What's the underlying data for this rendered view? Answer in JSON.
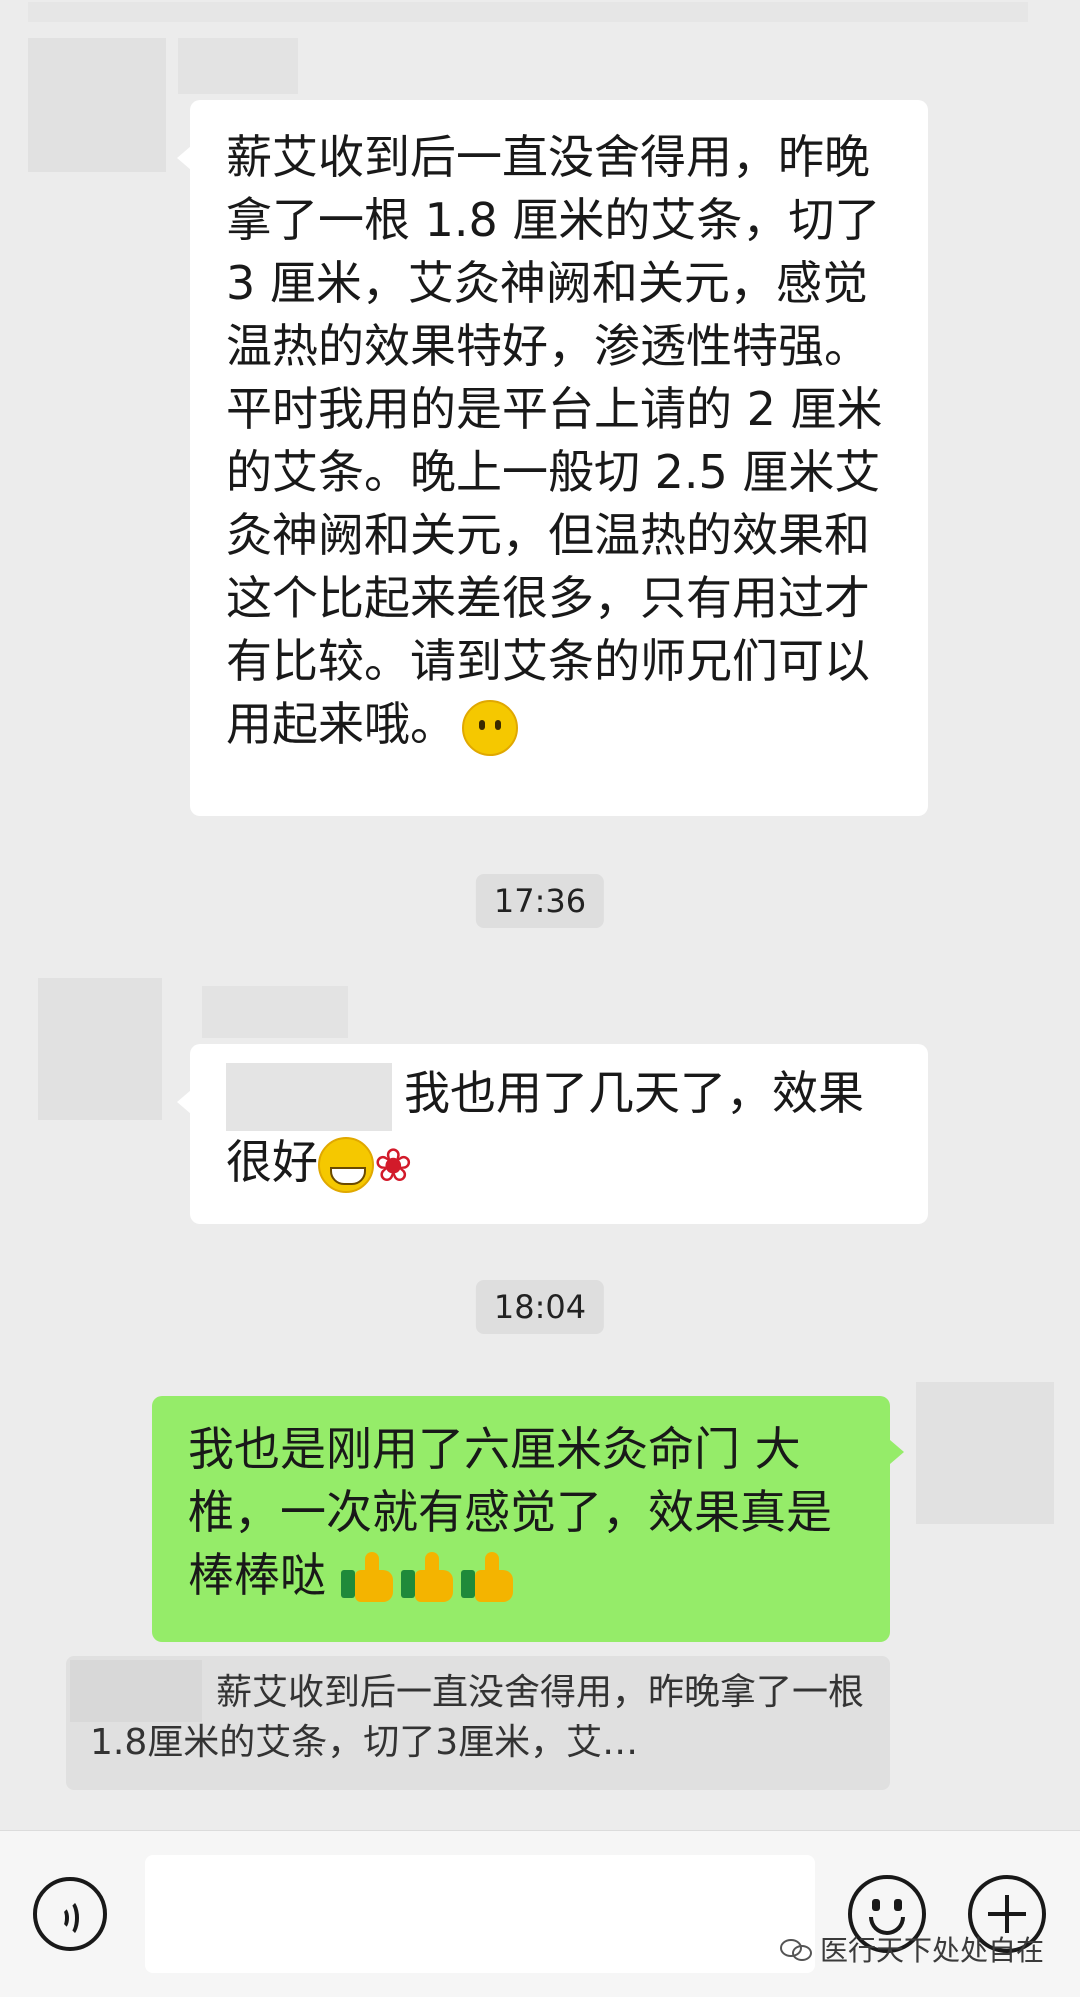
{
  "messages": [
    {
      "side": "left",
      "text": "薪艾收到后一直没舍得用，昨晚拿了一根 1.8 厘米的艾条，切了 3 厘米，艾灸神阙和关元，感觉温热的效果特好，渗透性特强。平时我用的是平台上请的 2 厘米的艾条。晚上一般切 2.5 厘米艾灸神阙和关元，但温热的效果和这个比起来差很多，只有用过才有比较。请到艾条的师兄们可以用起来哦。",
      "emoji": "smile-icon"
    },
    {
      "time": "17:36"
    },
    {
      "side": "left",
      "text": "我也用了几天了，效果很好",
      "emoji": [
        "grin-icon",
        "rose-icon"
      ]
    },
    {
      "time": "18:04"
    },
    {
      "side": "right",
      "text": "我也是刚用了六厘米灸命门 大椎，一次就有感觉了，效果真是棒棒哒",
      "emoji": [
        "thumbs-up-icon",
        "thumbs-up-icon",
        "thumbs-up-icon"
      ]
    }
  ],
  "quote": {
    "text": "薪艾收到后一直没舍得用，昨晚拿了一根1.8厘米的艾条，切了3厘米，艾…"
  },
  "input_bar": {
    "voice_icon": "voice-icon",
    "emoji_icon": "emoji-icon",
    "plus_icon": "plus-icon"
  },
  "watermark": {
    "text": "医行天下处处自在"
  }
}
